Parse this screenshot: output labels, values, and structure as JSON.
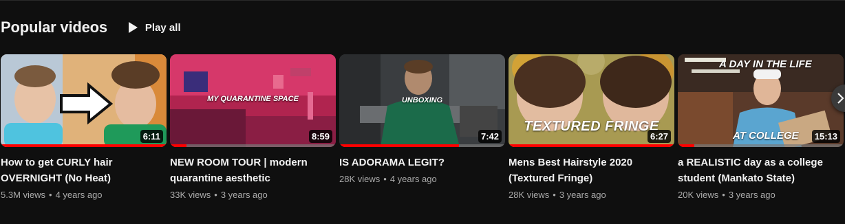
{
  "section": {
    "title": "Popular videos",
    "play_all_label": "Play all",
    "play_icon": "play-icon",
    "next_icon": "chevron-right-icon"
  },
  "colors": {
    "background": "#0f0f0f",
    "progress_red": "#ff0000",
    "meta_gray": "#aaaaaa"
  },
  "videos": [
    {
      "title": "How to get CURLY hair OVERNIGHT (No Heat)",
      "views": "5.3M views",
      "age": "4 years ago",
      "duration": "6:11",
      "overlay": "",
      "watched_fraction": 1.0
    },
    {
      "title": "NEW ROOM TOUR | modern quarantine aesthetic",
      "views": "33K views",
      "age": "3 years ago",
      "duration": "8:59",
      "overlay": "MY QUARANTINE SPACE",
      "watched_fraction": 0.1
    },
    {
      "title": "IS ADORAMA LEGIT?",
      "views": "28K views",
      "age": "4 years ago",
      "duration": "7:42",
      "overlay": "UNBOXING",
      "watched_fraction": 0.72
    },
    {
      "title": "Mens Best Hairstyle 2020 (Textured Fringe)",
      "views": "28K views",
      "age": "3 years ago",
      "duration": "6:27",
      "overlay": "TEXTURED FRINGE",
      "watched_fraction": 1.0
    },
    {
      "title": "a REALISTIC day as a college student (Mankato State)",
      "views": "20K views",
      "age": "3 years ago",
      "duration": "15:13",
      "overlay_top": "A DAY IN THE LIFE",
      "overlay": "AT COLLEGE",
      "watched_fraction": 0.1
    }
  ]
}
